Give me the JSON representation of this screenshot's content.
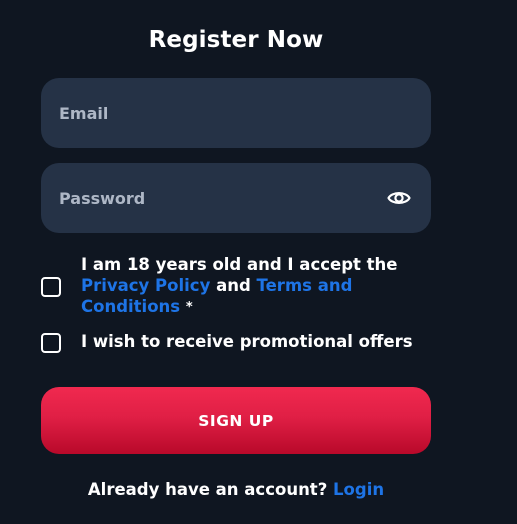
{
  "form": {
    "title": "Register Now",
    "email": {
      "placeholder": "Email",
      "value": ""
    },
    "password": {
      "placeholder": "Password",
      "value": ""
    },
    "age_check": {
      "text_before": "I am 18 years old and I accept the",
      "privacy_link": "Privacy Policy",
      "and_text": "and",
      "terms_link": "Terms and Conditions",
      "required_mark": "*"
    },
    "promo_check": {
      "label": "I wish to receive promotional offers"
    },
    "signup_label": "SIGN UP",
    "footer": {
      "question": "Already have an account?",
      "login_link": "Login"
    }
  },
  "colors": {
    "background": "#0f1621",
    "field_background": "#253246",
    "link": "#1e74e6",
    "button_top": "#f0294f",
    "button_bottom": "#b8092a"
  },
  "icons": {
    "password_toggle": "eye-icon"
  }
}
